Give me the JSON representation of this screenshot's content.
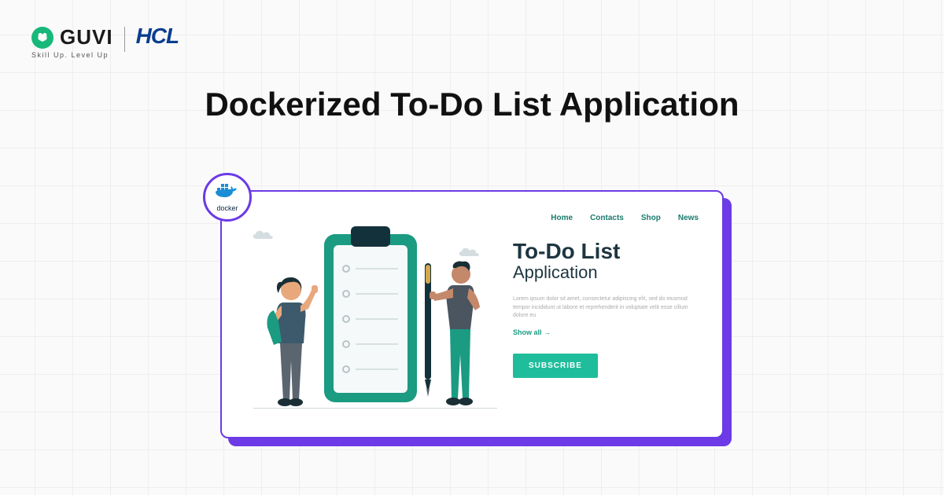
{
  "brand": {
    "guvi": "GUVI",
    "tagline": "Skill Up. Level Up",
    "hcl": "HCL"
  },
  "title": "Dockerized To-Do List Application",
  "docker": {
    "label": "docker"
  },
  "card": {
    "nav": [
      "Home",
      "Contacts",
      "Shop",
      "News"
    ],
    "heading1": "To-Do List",
    "heading2": "Application",
    "lorem": "Lorem ipsum dolor sit amet, consectetur adipiscing elit, sed do eiusmod tempor incididunt ut labore et reprehenderit in voluptate velit esse cillum dolore eu",
    "show_all": "Show all →",
    "subscribe": "SUBSCRIBE"
  }
}
